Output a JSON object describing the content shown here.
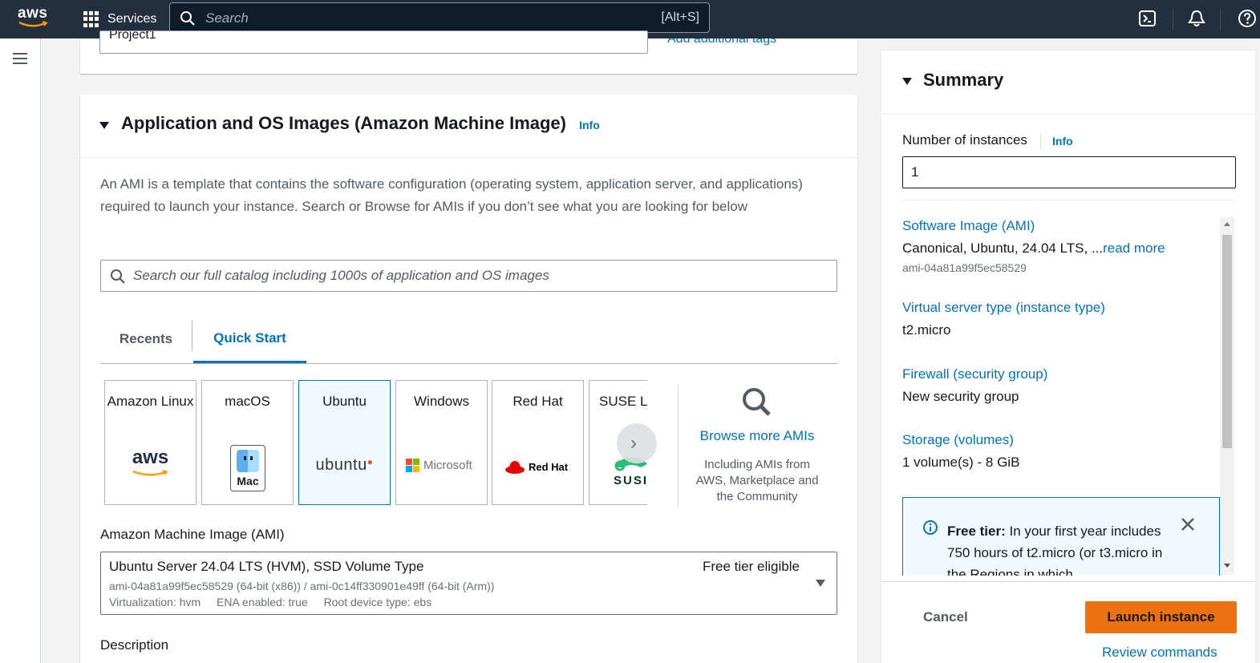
{
  "topnav": {
    "logo_text": "aws",
    "services_label": "Services",
    "search_placeholder": "Search",
    "search_shortcut": "[Alt+S]",
    "icons": [
      "cloudshell-icon",
      "notifications-icon",
      "help-icon"
    ]
  },
  "previous_card": {
    "name_value": "Project1",
    "add_tags_link": "Add additional tags"
  },
  "ami_section": {
    "title": "Application and OS Images (Amazon Machine Image)",
    "info": "Info",
    "description": "An AMI is a template that contains the software configuration (operating system, application server, and applications) required to launch your instance. Search or Browse for AMIs if you don’t see what you are looking for below",
    "search_placeholder": "Search our full catalog including 1000s of application and OS images",
    "tabs": [
      {
        "label": "Recents",
        "active": false
      },
      {
        "label": "Quick Start",
        "active": true
      }
    ],
    "tiles": [
      {
        "name": "Amazon Linux",
        "logo": "aws",
        "selected": false
      },
      {
        "name": "macOS",
        "logo": "Mac",
        "selected": false
      },
      {
        "name": "Ubuntu",
        "logo": "ubuntu",
        "selected": true
      },
      {
        "name": "Windows",
        "logo": "Microsoft",
        "selected": false
      },
      {
        "name": "Red Hat",
        "logo": "Red Hat",
        "selected": false
      },
      {
        "name": "SUSE Li",
        "logo": "SUSI",
        "selected": false
      }
    ],
    "browse": {
      "link": "Browse more AMIs",
      "subtext": "Including AMIs from AWS, Marketplace and the Community"
    },
    "ami_label": "Amazon Machine Image (AMI)",
    "selected_ami": {
      "name": "Ubuntu Server 24.04 LTS (HVM), SSD Volume Type",
      "badge": "Free tier eligible",
      "ids": "ami-04a81a99f5ec58529 (64-bit (x86)) / ami-0c14ff330901e49ff (64-bit (Arm))",
      "virtualization": "Virtualization: hvm",
      "ena": "ENA enabled: true",
      "root_device": "Root device type: ebs"
    },
    "description_label": "Description"
  },
  "summary": {
    "title": "Summary",
    "instances_label": "Number of instances",
    "instances_info": "Info",
    "instances_value": "1",
    "items": [
      {
        "key": "Software Image (AMI)",
        "value": "Canonical, Ubuntu, 24.04 LTS, ...",
        "link": "read more",
        "sub": "ami-04a81a99f5ec58529"
      },
      {
        "key": "Virtual server type (instance type)",
        "value": "t2.micro"
      },
      {
        "key": "Firewall (security group)",
        "value": "New security group"
      },
      {
        "key": "Storage (volumes)",
        "value": "1 volume(s) - 8 GiB"
      }
    ],
    "free_tier": {
      "bold": "Free tier:",
      "text": " In your first year includes 750 hours of t2.micro (or t3.micro in the Regions in which"
    },
    "cancel": "Cancel",
    "launch": "Launch instance",
    "review": "Review commands"
  },
  "colors": {
    "nav_bg": "#232f3e",
    "link": "#0073bb",
    "launch_orange": "#ec7211",
    "selected_tile_bg": "#f1faff"
  }
}
